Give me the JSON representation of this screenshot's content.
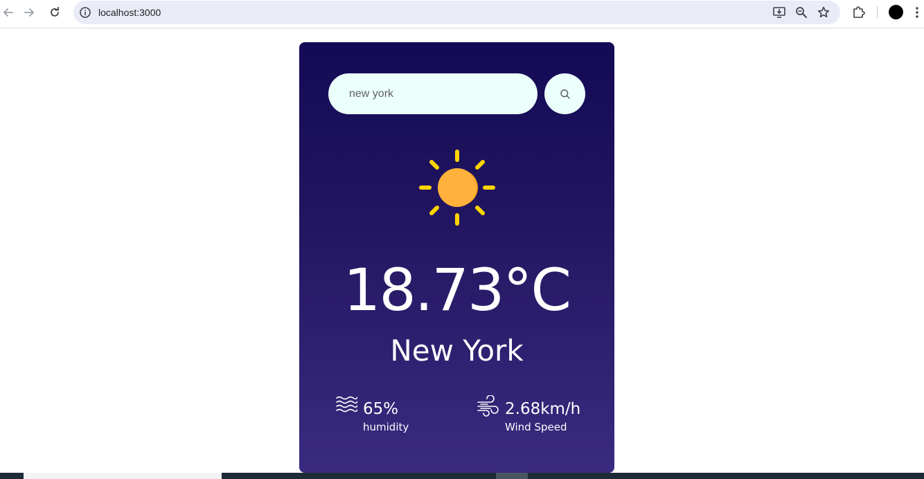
{
  "browser": {
    "url": "localhost:3000",
    "icons": {
      "back": "arrow-left-icon",
      "forward": "arrow-right-icon",
      "reload": "reload-icon",
      "site_info": "info-icon",
      "install": "install-app-icon",
      "zoom": "zoom-icon",
      "bookmark": "star-icon",
      "extensions": "puzzle-icon",
      "menu": "kebab-menu-icon"
    }
  },
  "weather": {
    "search": {
      "value": "new york",
      "icon": "search-icon"
    },
    "condition_icon": "sun-icon",
    "temperature": "18.73°C",
    "city": "New York",
    "humidity": {
      "value": "65%",
      "label": "humidity",
      "icon": "humidity-waves-icon"
    },
    "wind": {
      "value": "2.68km/h",
      "label": "Wind Speed",
      "icon": "wind-icon"
    }
  },
  "colors": {
    "card_top": "#130a55",
    "card_bottom": "#3a2b80",
    "input_bg": "#ebfffc",
    "sun_core": "#ffb13b",
    "sun_rays": "#ffd400"
  }
}
